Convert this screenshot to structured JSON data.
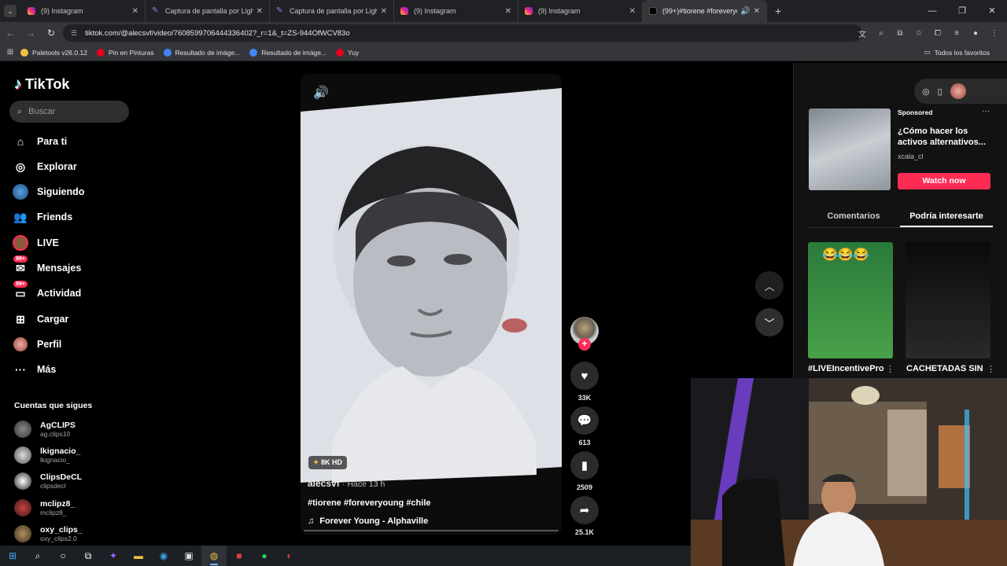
{
  "browser": {
    "tabs": [
      {
        "title": "(9) Instagram",
        "favicon": "instagram-icon"
      },
      {
        "title": "Captura de pantalla por Lightsh",
        "favicon": "lightshot-icon"
      },
      {
        "title": "Captura de pantalla por Lightsh",
        "favicon": "lightshot-icon"
      },
      {
        "title": "(9) Instagram",
        "favicon": "instagram-icon"
      },
      {
        "title": "(9) Instagram",
        "favicon": "instagram-icon"
      },
      {
        "title": "(99+)#tiorene #foreveryoun",
        "favicon": "tiktok-icon",
        "active": true
      }
    ],
    "url": "tiktok.com/@alecsvf/video/7608599706444336402?_r=1&_t=ZS-944OfWCV83o",
    "bookmarks": [
      {
        "label": "Paletools v26.0.12",
        "color": "#f0c040"
      },
      {
        "label": "Pin en Pinturas",
        "color": "#e60023"
      },
      {
        "label": "Resultado de imáge...",
        "color": "#4285f4"
      },
      {
        "label": "Resultado de imáge...",
        "color": "#4285f4"
      },
      {
        "label": "Yuy",
        "color": "#e60023"
      }
    ],
    "all_bookmarks": "Todos los favoritos"
  },
  "sidebar": {
    "logo": "TikTok",
    "search_placeholder": "Buscar",
    "items": [
      {
        "label": "Para ti",
        "icon": "home-icon"
      },
      {
        "label": "Explorar",
        "icon": "compass-icon"
      },
      {
        "label": "Siguiendo",
        "icon": "following-avatar-icon"
      },
      {
        "label": "Friends",
        "icon": "friends-icon"
      },
      {
        "label": "LIVE",
        "icon": "live-icon"
      },
      {
        "label": "Mensajes",
        "icon": "messages-icon",
        "badge": "99+"
      },
      {
        "label": "Actividad",
        "icon": "activity-icon",
        "badge": "99+"
      },
      {
        "label": "Cargar",
        "icon": "upload-icon"
      },
      {
        "label": "Perfil",
        "icon": "profile-icon"
      },
      {
        "label": "Más",
        "icon": "more-icon"
      }
    ],
    "following_heading": "Cuentas que sigues",
    "following": [
      {
        "name": "AgCLIPS",
        "user": "ag.clips10"
      },
      {
        "name": "lkignacio_",
        "user": "lkignacio_"
      },
      {
        "name": "ClipsDeCL",
        "user": "clipsdecl"
      },
      {
        "name": "mclipz8_",
        "user": "mclipz8_"
      },
      {
        "name": "oxy_clips_",
        "user": "oxy_clips2.0"
      }
    ]
  },
  "video": {
    "quality_badge": "8K HD",
    "author": "alecsvf",
    "time": "· Hace 13 h",
    "caption": "#tiorene #foreveryoung #chile",
    "music": "Forever Young - Alphaville",
    "likes": "33K",
    "comments": "613",
    "saves": "2509",
    "shares": "25.1K"
  },
  "right_panel": {
    "sponsored": "Sponsored",
    "ad_title": "¿Cómo hacer los activos alternativos...",
    "ad_brand": "xcala_cl",
    "watch_now": "Watch now",
    "tab_comments": "Comentarios",
    "tab_interest": "Podría interesarte",
    "recommended": [
      {
        "title": "#LIVEIncentivePro"
      },
      {
        "title": "CACHETADAS SIN"
      }
    ]
  }
}
